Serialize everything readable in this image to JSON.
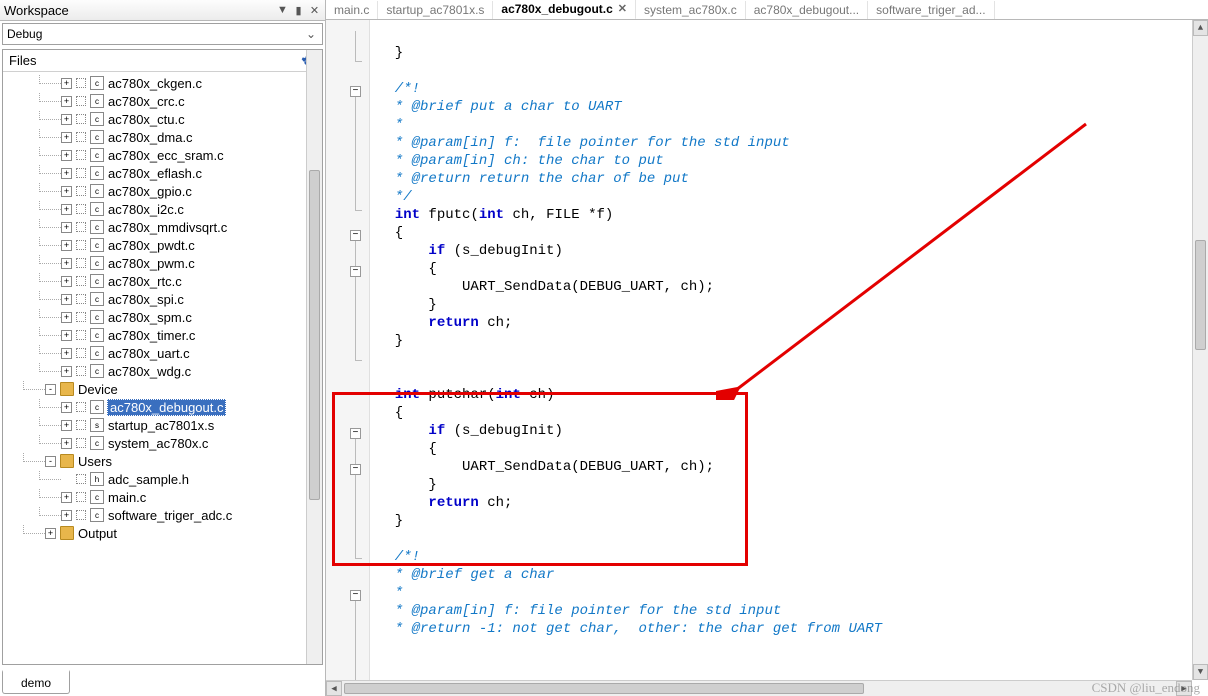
{
  "workspace": {
    "title": "Workspace",
    "dropdown": "Debug",
    "filesHeader": "Files",
    "tab": "demo"
  },
  "tree": [
    {
      "d": 2,
      "exp": "+",
      "ico": "c",
      "name": "ac780x_ckgen.c"
    },
    {
      "d": 2,
      "exp": "+",
      "ico": "c",
      "name": "ac780x_crc.c"
    },
    {
      "d": 2,
      "exp": "+",
      "ico": "c",
      "name": "ac780x_ctu.c"
    },
    {
      "d": 2,
      "exp": "+",
      "ico": "c",
      "name": "ac780x_dma.c"
    },
    {
      "d": 2,
      "exp": "+",
      "ico": "c",
      "name": "ac780x_ecc_sram.c"
    },
    {
      "d": 2,
      "exp": "+",
      "ico": "c",
      "name": "ac780x_eflash.c"
    },
    {
      "d": 2,
      "exp": "+",
      "ico": "c",
      "name": "ac780x_gpio.c"
    },
    {
      "d": 2,
      "exp": "+",
      "ico": "c",
      "name": "ac780x_i2c.c"
    },
    {
      "d": 2,
      "exp": "+",
      "ico": "c",
      "name": "ac780x_mmdivsqrt.c"
    },
    {
      "d": 2,
      "exp": "+",
      "ico": "c",
      "name": "ac780x_pwdt.c"
    },
    {
      "d": 2,
      "exp": "+",
      "ico": "c",
      "name": "ac780x_pwm.c"
    },
    {
      "d": 2,
      "exp": "+",
      "ico": "c",
      "name": "ac780x_rtc.c"
    },
    {
      "d": 2,
      "exp": "+",
      "ico": "c",
      "name": "ac780x_spi.c"
    },
    {
      "d": 2,
      "exp": "+",
      "ico": "c",
      "name": "ac780x_spm.c"
    },
    {
      "d": 2,
      "exp": "+",
      "ico": "c",
      "name": "ac780x_timer.c"
    },
    {
      "d": 2,
      "exp": "+",
      "ico": "c",
      "name": "ac780x_uart.c"
    },
    {
      "d": 2,
      "exp": "+",
      "ico": "c",
      "name": "ac780x_wdg.c"
    },
    {
      "d": 1,
      "exp": "-",
      "ico": "folder",
      "name": "Device"
    },
    {
      "d": 2,
      "exp": "+",
      "ico": "c",
      "name": "ac780x_debugout.c",
      "sel": true
    },
    {
      "d": 2,
      "exp": "+",
      "ico": "s",
      "name": "startup_ac7801x.s"
    },
    {
      "d": 2,
      "exp": "+",
      "ico": "c",
      "name": "system_ac780x.c"
    },
    {
      "d": 1,
      "exp": "-",
      "ico": "folder",
      "name": "Users"
    },
    {
      "d": 2,
      "exp": "",
      "ico": "h",
      "name": "adc_sample.h"
    },
    {
      "d": 2,
      "exp": "+",
      "ico": "c",
      "name": "main.c"
    },
    {
      "d": 2,
      "exp": "+",
      "ico": "c",
      "name": "software_triger_adc.c"
    },
    {
      "d": 1,
      "exp": "+",
      "ico": "folder",
      "name": "Output"
    }
  ],
  "tabs": [
    {
      "label": "main.c",
      "active": false
    },
    {
      "label": "startup_ac7801x.s",
      "active": false
    },
    {
      "label": "ac780x_debugout.c",
      "active": true,
      "close": true
    },
    {
      "label": "system_ac780x.c",
      "active": false
    },
    {
      "label": "ac780x_debugout...",
      "active": false
    },
    {
      "label": "software_triger_ad...",
      "active": false
    }
  ],
  "code": {
    "ln1": "  }",
    "ln2": "",
    "ln3": "  /*!",
    "ln4": "  * @brief put a char to UART",
    "ln5": "  *",
    "ln6": "  * @param[in] f:  file pointer for the std input",
    "ln7": "  * @param[in] ch: the char to put",
    "ln8": "  * @return return the char of be put",
    "ln9": "  */",
    "fn1_a": "int",
    "fn1_b": " fputc(",
    "fn1_c": "int",
    "fn1_d": " ch, FILE *f)",
    "ln11": "  {",
    "ln12_a": "      ",
    "ln12_b": "if",
    "ln12_c": " (s_debugInit)",
    "ln13": "      {",
    "ln14": "          UART_SendData(DEBUG_UART, ch);",
    "ln15": "      }",
    "ln16_a": "      ",
    "ln16_b": "return",
    "ln16_c": " ch;",
    "ln17": "  }",
    "fn2_a": "int",
    "fn2_b": " putchar(",
    "fn2_c": "int",
    "fn2_d": " ch)",
    "ln21": "  {",
    "ln22_a": "      ",
    "ln22_b": "if",
    "ln22_c": " (s_debugInit)",
    "ln23": "      {",
    "ln24": "          UART_SendData(DEBUG_UART, ch);",
    "ln25": "      }",
    "ln26_a": "      ",
    "ln26_b": "return",
    "ln26_c": " ch;",
    "ln27": "  }",
    "ln30": "  /*!",
    "ln31": "  * @brief get a char",
    "ln32": "  *",
    "ln33": "  * @param[in] f: file pointer for the std input",
    "ln34": "  * @return -1: not get char,  other: the char get from UART"
  },
  "watermark": "CSDN @liu_endong"
}
